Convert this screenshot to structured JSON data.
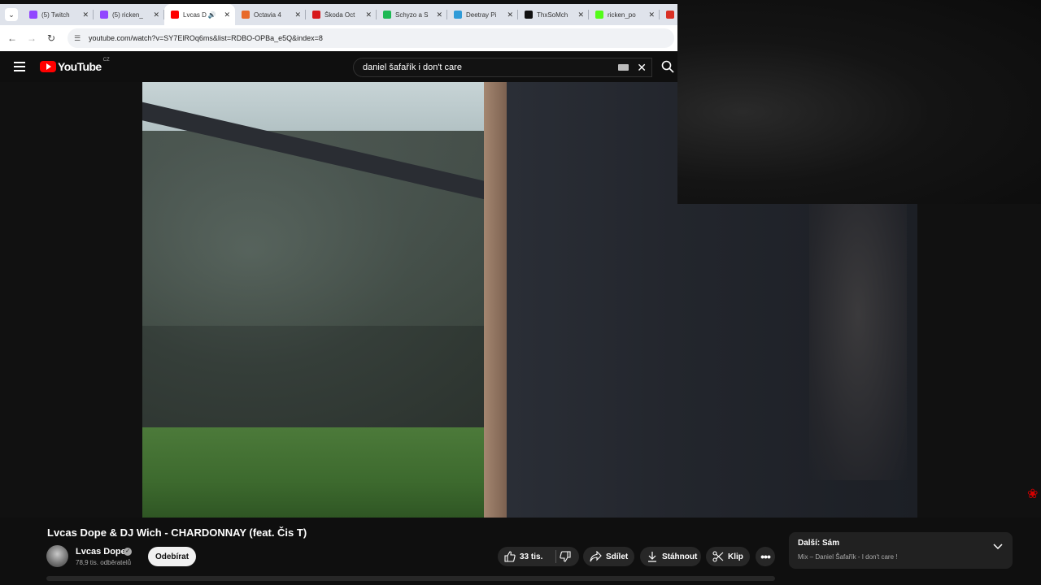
{
  "browser": {
    "tabs": [
      {
        "title": "(5) Twitch",
        "color": "#9146ff",
        "active": false,
        "audio": false
      },
      {
        "title": "(5) ricken_",
        "color": "#9146ff",
        "active": false,
        "audio": false
      },
      {
        "title": "Lvcas D",
        "color": "#ff0000",
        "active": true,
        "audio": true
      },
      {
        "title": "Octavia 4",
        "color": "#e86a2a",
        "active": false,
        "audio": false
      },
      {
        "title": "Škoda Oct",
        "color": "#d7191c",
        "active": false,
        "audio": false
      },
      {
        "title": "Schyzo a S",
        "color": "#1db954",
        "active": false,
        "audio": false
      },
      {
        "title": "Deetray Pi",
        "color": "#2f9bd8",
        "active": false,
        "audio": false
      },
      {
        "title": "ThxSoMch",
        "color": "#111111",
        "active": false,
        "audio": false
      },
      {
        "title": "ricken_po",
        "color": "#53fc18",
        "active": false,
        "audio": false
      },
      {
        "title": "",
        "color": "#d93025",
        "active": false,
        "audio": false
      }
    ],
    "url": "youtube.com/watch?v=SY7ElROq6ms&list=RDBO-OPBa_e5Q&index=8"
  },
  "youtube": {
    "logo_text": "YouTube",
    "region": "CZ",
    "search_query": "daniel šafařík i don't care"
  },
  "video": {
    "title": "Lvcas Dope & DJ Wich - CHARDONNAY (feat. Čis T)",
    "channel": "Lvcas Dope",
    "subscribers": "78,9 tis. odběratelů",
    "subscribe_label": "Odebírat",
    "likes": "33 tis.",
    "share_label": "Sdílet",
    "download_label": "Stáhnout",
    "clip_label": "Klip"
  },
  "up_next": {
    "title": "Další: Sám",
    "subtitle": "Mix – Daniel Šafařík - I don't care !"
  },
  "colors": {
    "youtube_red": "#ff0000",
    "background": "#0f0f0f",
    "pill": "#272727"
  }
}
